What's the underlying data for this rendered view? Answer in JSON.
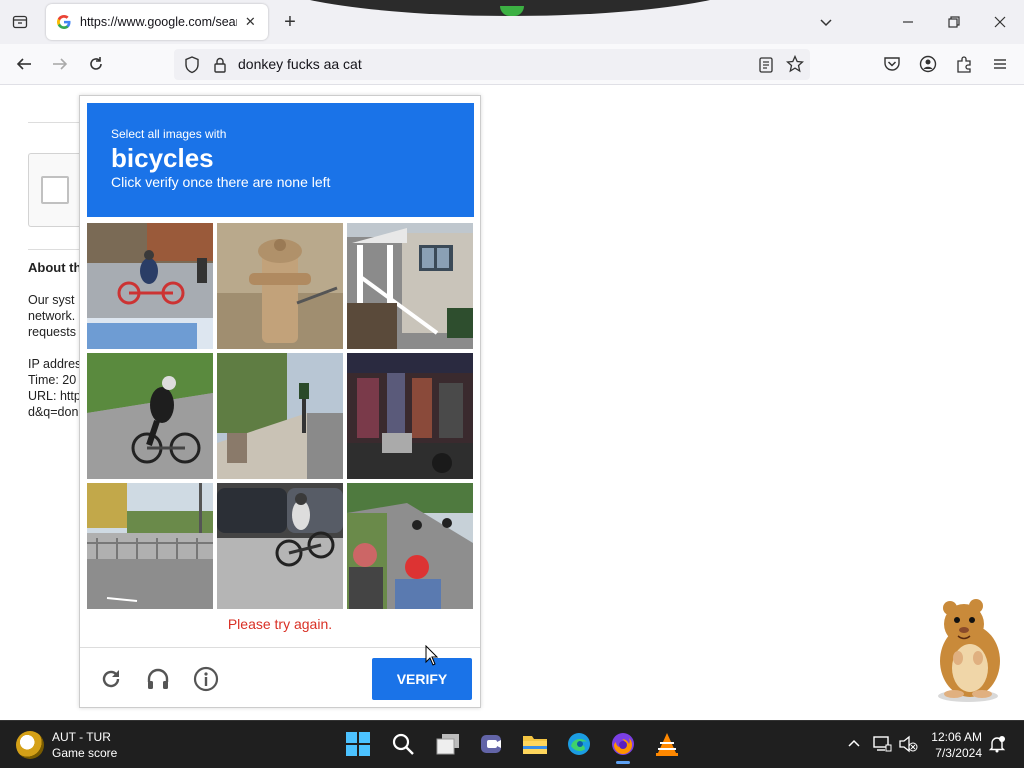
{
  "browser": {
    "tab": {
      "title": "https://www.google.com/sear",
      "favicon": "google-g-icon"
    },
    "url": "donkey fucks aa cat",
    "window_controls": [
      "minimize-icon",
      "restore-icon",
      "close-icon"
    ]
  },
  "page": {
    "about_heading": "About th",
    "paragraph": "Our syst\nnetwork.\nrequests",
    "meta": "IP addres\nTime: 20\nURL: http\nd&q=don"
  },
  "captcha": {
    "instruction_small": "Select all images with",
    "target": "bicycles",
    "instruction_sub": "Click verify once there are none left",
    "tiles": [
      "street-cyclist-red-bike",
      "fire-hydrant",
      "house-porch-stairs",
      "cyclist-on-road",
      "sidewalk-street",
      "market-stalls",
      "fence-street",
      "cyclist-parked-cars",
      "road-with-pedestrians"
    ],
    "error": "Please try again.",
    "verify_label": "VERIFY",
    "header_color": "#1a73e8",
    "error_color": "#d93025"
  },
  "taskbar": {
    "widget": {
      "title": "AUT - TUR",
      "subtitle": "Game score"
    },
    "apps": [
      "windows-start-icon",
      "search-icon",
      "task-view-icon",
      "teams-icon",
      "file-explorer-icon",
      "edge-icon",
      "firefox-icon",
      "vlc-icon"
    ],
    "active_app": "firefox-icon",
    "clock": {
      "time": "12:06 AM",
      "date": "7/3/2024"
    }
  }
}
